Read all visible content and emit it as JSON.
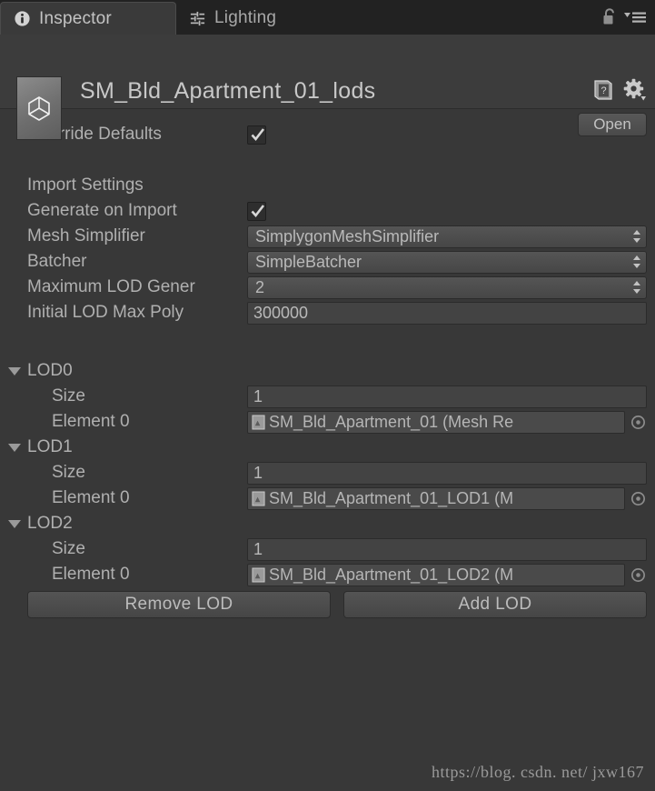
{
  "window": {
    "tabs": [
      {
        "label": "Inspector",
        "icon": "info-circle-icon",
        "active": true
      },
      {
        "label": "Lighting",
        "icon": "lighting-sliders-icon",
        "active": false
      }
    ],
    "lock_icon": "lock-open-icon",
    "menu_icon": "hamburger-menu-icon"
  },
  "object_header": {
    "title": "SM_Bld_Apartment_01_lods",
    "thumbnail_icon": "unity-prefab-icon",
    "help_icon": "help-book-icon",
    "settings_icon": "gear-icon",
    "open_button": "Open"
  },
  "properties": {
    "override_defaults": {
      "label": "Override Defaults",
      "checked": true
    },
    "import_settings_header": "Import Settings",
    "generate_on_import": {
      "label": "Generate on Import",
      "checked": true
    },
    "mesh_simplifier": {
      "label": "Mesh Simplifier",
      "value": "SimplygonMeshSimplifier"
    },
    "batcher": {
      "label": "Batcher",
      "value": "SimpleBatcher"
    },
    "maximum_lod_generated": {
      "label": "Maximum LOD Gener",
      "value": "2"
    },
    "initial_lod_max_poly": {
      "label": "Initial LOD Max Poly",
      "value": "300000"
    }
  },
  "lod_groups": [
    {
      "name": "LOD0",
      "expanded": true,
      "size_label": "Size",
      "size_value": "1",
      "elements": [
        {
          "label": "Element 0",
          "value": "SM_Bld_Apartment_01 (Mesh Re",
          "icon": "mesh-renderer-icon",
          "picker_icon": "object-picker-icon"
        }
      ]
    },
    {
      "name": "LOD1",
      "expanded": true,
      "size_label": "Size",
      "size_value": "1",
      "elements": [
        {
          "label": "Element 0",
          "value": "SM_Bld_Apartment_01_LOD1 (M",
          "icon": "mesh-renderer-icon",
          "picker_icon": "object-picker-icon"
        }
      ]
    },
    {
      "name": "LOD2",
      "expanded": true,
      "size_label": "Size",
      "size_value": "1",
      "elements": [
        {
          "label": "Element 0",
          "value": "SM_Bld_Apartment_01_LOD2 (M",
          "icon": "mesh-renderer-icon",
          "picker_icon": "object-picker-icon"
        }
      ]
    }
  ],
  "footer_buttons": {
    "remove_lod": "Remove LOD",
    "add_lod": "Add LOD"
  },
  "watermark": "https://blog. csdn. net/ jxw167",
  "colors": {
    "window_background": "#383838",
    "tabbar_background": "#222222",
    "active_tab_background": "#3a3a3a",
    "header_background": "#3c3c3c",
    "text": "#b0b0b0",
    "field_background": "#434343",
    "popup_background": "#4e4e4e"
  }
}
